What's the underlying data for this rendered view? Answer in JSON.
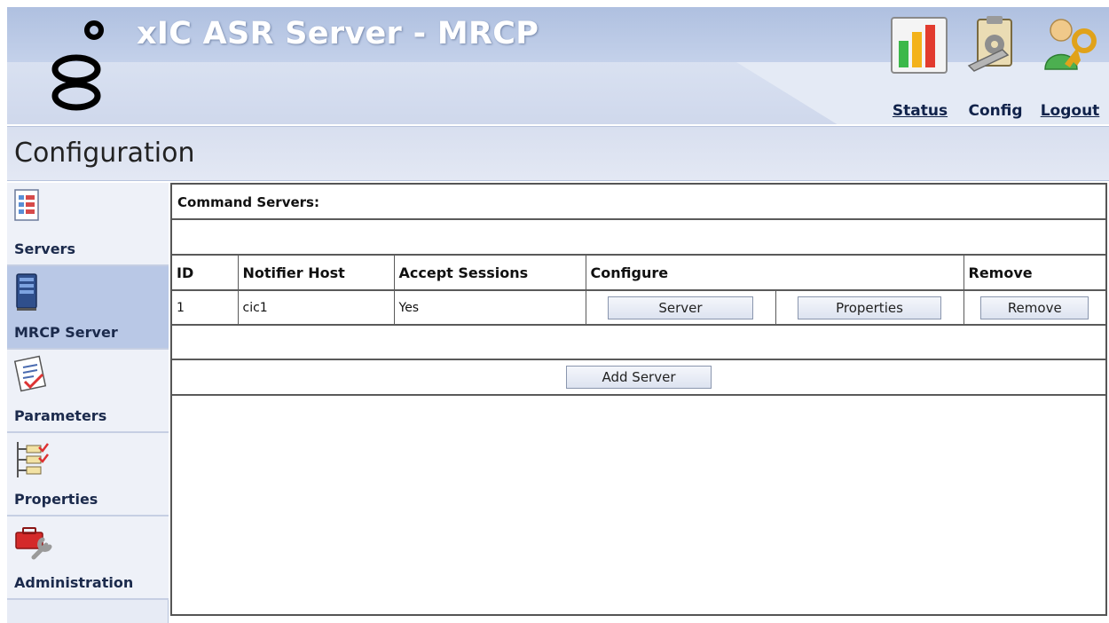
{
  "header": {
    "app_title": "xIC ASR Server - MRCP",
    "nav": [
      {
        "label": "Status",
        "icon": "status-chart-icon",
        "link": true
      },
      {
        "label": "Config",
        "icon": "config-clipboard-icon",
        "link": false
      },
      {
        "label": "Logout",
        "icon": "logout-user-key-icon",
        "link": true
      }
    ]
  },
  "page": {
    "title": "Configuration"
  },
  "sidebar": {
    "items": [
      {
        "label": "Servers",
        "icon": "servers-checklist-icon",
        "active": false
      },
      {
        "label": "MRCP Server",
        "icon": "server-tower-icon",
        "active": true
      },
      {
        "label": "Parameters",
        "icon": "parameters-document-icon",
        "active": false
      },
      {
        "label": "Properties",
        "icon": "properties-tree-icon",
        "active": false
      },
      {
        "label": "Administration",
        "icon": "administration-toolbox-icon",
        "active": false
      }
    ]
  },
  "content": {
    "section_title": "Command Servers:",
    "columns": {
      "id": "ID",
      "notifier_host": "Notifier Host",
      "accept_sessions": "Accept Sessions",
      "configure": "Configure",
      "remove": "Remove"
    },
    "rows": [
      {
        "id": "1",
        "notifier_host": "cic1",
        "accept_sessions": "Yes",
        "server_button": "Server",
        "properties_button": "Properties",
        "remove_button": "Remove"
      }
    ],
    "add_button": "Add Server"
  },
  "colors": {
    "header_bg": "#cfd9ec",
    "active_sidebar": "#b9c8e6",
    "grid_line": "#5a5a5a"
  }
}
